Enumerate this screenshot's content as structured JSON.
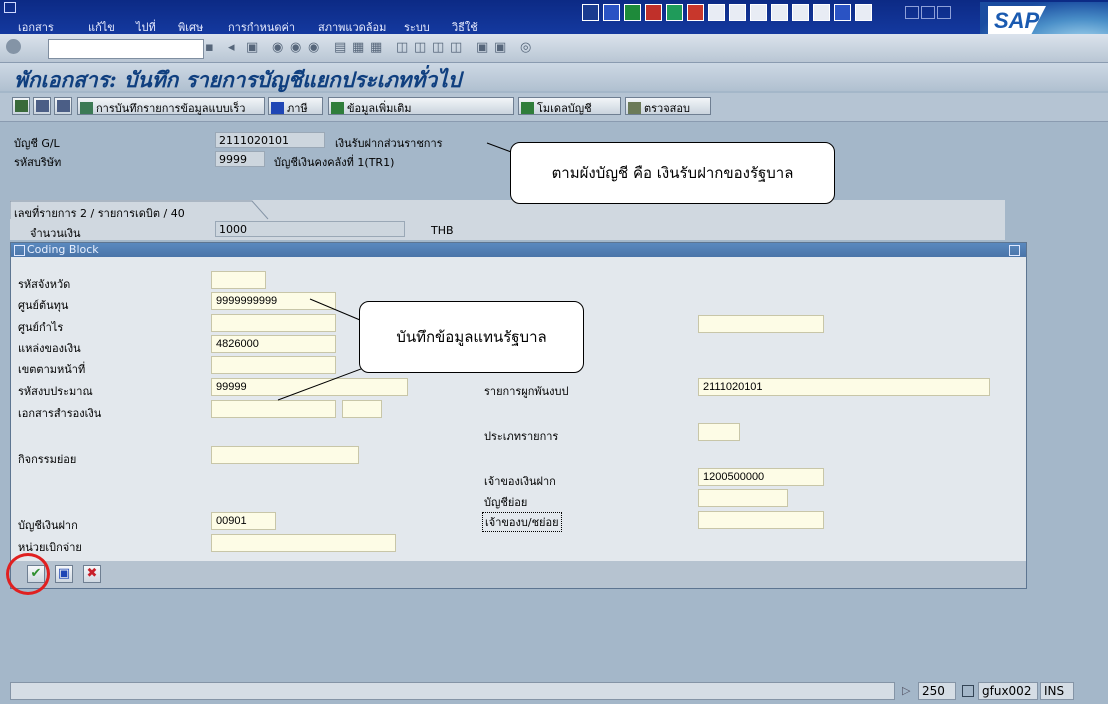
{
  "menu": {
    "items": [
      "เอกสาร",
      "แก้ไข",
      "ไปที่",
      "พิเศษ",
      "การกำหนดค่า",
      "สภาพแวดล้อม",
      "ระบบ",
      "วิธีใช้"
    ],
    "brand": "SAP"
  },
  "page_title": "พักเอกสาร: บันทึก รายการบัญชีแยกประเภททั่วไป",
  "app_toolbar": {
    "quick_entry": "การบันทึกรายการข้อมูลแบบเร็ว",
    "tax": "ภาษี",
    "additional_data": "ข้อมูลเพิ่มเติม",
    "account_model": "โมเดลบัญชี",
    "check": "ตรวจสอบ"
  },
  "header": {
    "gl_label": "บัญชี G/L",
    "gl_value": "2111020101",
    "gl_desc": "เงินรับฝากส่วนราชการ",
    "company_label": "รหัสบริษัท",
    "company_value": "9999",
    "company_desc": "บัญชีเงินคงคลังที่ 1(TR1)"
  },
  "tab": {
    "label": "เลขที่รายการ 2 / รายการเดบิต / 40",
    "amount_label": "จำนวนเงิน",
    "amount_value": "1000",
    "currency": "THB"
  },
  "coding_block": {
    "title": "Coding Block",
    "left": [
      {
        "label": "รหัสจังหวัด",
        "value": ""
      },
      {
        "label": "ศูนย์ต้นทุน",
        "value": "9999999999"
      },
      {
        "label": "ศูนย์กำไร",
        "value": ""
      },
      {
        "label": "แหล่งของเงิน",
        "value": "4826000"
      },
      {
        "label": "เขตตามหน้าที่",
        "value": ""
      },
      {
        "label": "รหัสงบประมาณ",
        "value": "99999"
      },
      {
        "label": "เอกสารสำรองเงิน",
        "value": ""
      },
      {
        "label": "กิจกรรมย่อย",
        "value": ""
      },
      {
        "label": "บัญชีเงินฝาก",
        "value": "00901"
      },
      {
        "label": "หน่วยเบิกจ่าย",
        "value": ""
      }
    ],
    "right": [
      {
        "label": "รายการผูกพันงบป",
        "value": "2111020101"
      },
      {
        "label": "ประเภทรายการ",
        "value": ""
      },
      {
        "label": "เจ้าของเงินฝาก",
        "value": "1200500000"
      },
      {
        "label": "บัญชีย่อย",
        "value": ""
      },
      {
        "label": "เจ้าของบ/ชย่อย",
        "value": ""
      }
    ]
  },
  "callouts": {
    "chart_of_accounts": "ตามผังบัญชี คือ เงินรับฝากของรัฐบาล",
    "on_behalf": "บันทึกข้อมูลแทนรัฐบาล"
  },
  "statusbar": {
    "client": "250",
    "server": "gfux002",
    "mode": "INS"
  },
  "colors": {
    "menubar": "#14399f",
    "background": "#a4b7c9",
    "input_fill": "#fdfce6",
    "title_text": "#0f3f7f",
    "highlight_circle": "#e02020"
  }
}
